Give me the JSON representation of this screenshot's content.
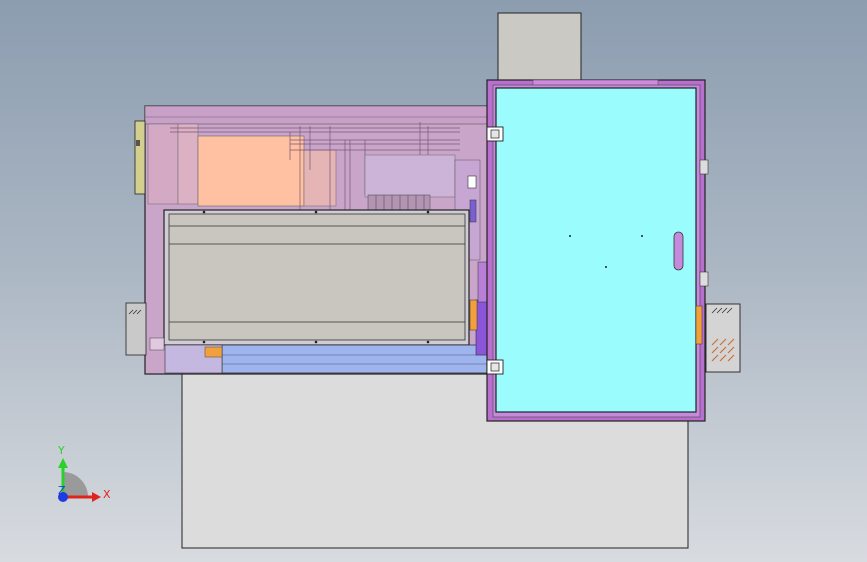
{
  "viewport": {
    "background_top": "#8c9db0",
    "background_bottom": "#d8dbe0"
  },
  "colors": {
    "base_plate": "#dcdcdc",
    "top_block": "#cbc9c4",
    "main_body": "#c9a6c9",
    "frame_magenta": "#b96fd0",
    "cyan_door": "#9afcfc",
    "salmon": "#ffc1a1",
    "tray_gray": "#c9c5bf",
    "tray_blue": "#9eb4ef",
    "orange": "#f2a03c",
    "purple": "#8a55d8",
    "outline": "#222222"
  },
  "triad": {
    "x_label": "X",
    "y_label": "Y",
    "z_label": "Z",
    "x_color": "#e0231c",
    "y_color": "#2bd12b",
    "z_color": "#1d3be0"
  }
}
